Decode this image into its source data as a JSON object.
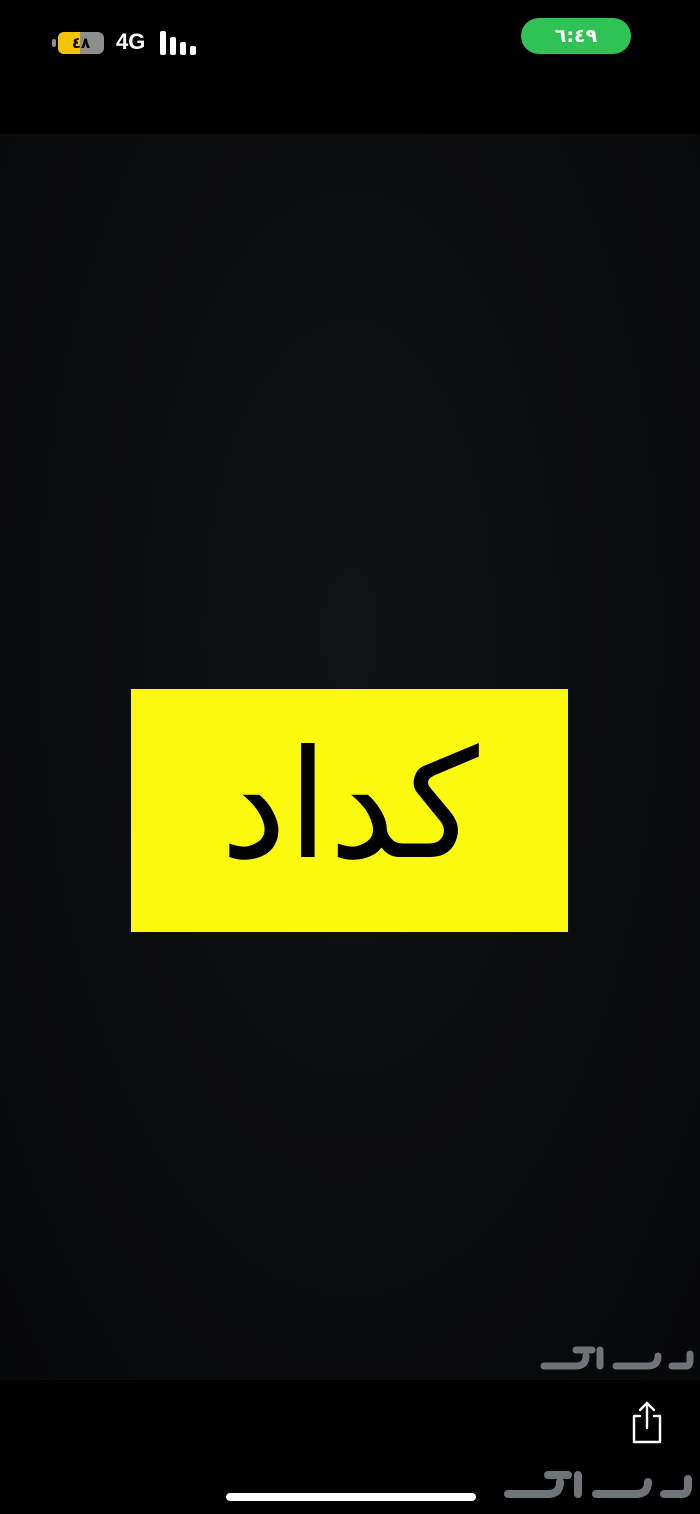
{
  "status_bar": {
    "battery_level": "٤٨",
    "battery_fraction": 0.48,
    "network": "4G",
    "time": "٦:٤٩",
    "signal_bars": 4
  },
  "photo": {
    "sign_text": "كداد",
    "sign_color": "#fbfa0e"
  },
  "watermark": {
    "logo_text": "حراج"
  },
  "toolbar": {
    "share_icon": "share-icon"
  },
  "colors": {
    "clock_pill": "#30c254",
    "battery_fill": "#f5c400"
  }
}
